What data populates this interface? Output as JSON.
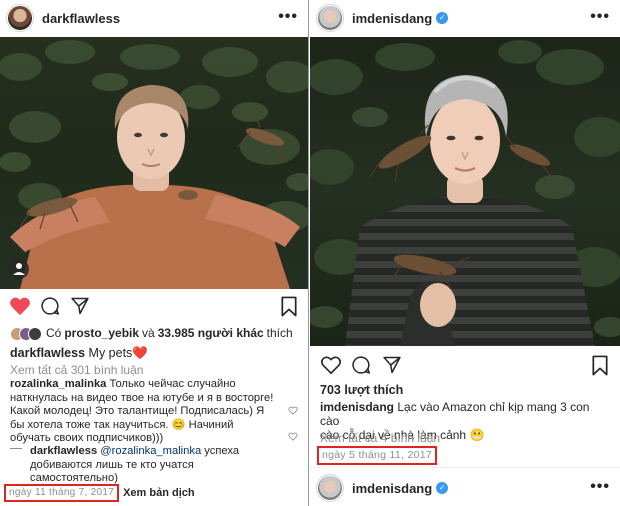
{
  "left_post": {
    "username": "darkflawless",
    "liked_by_prefix": "Có",
    "liked_by_user": "prosto_yebik",
    "liked_by_suffix_and": "và",
    "liked_by_others": "33.985 người khác",
    "liked_by_action": "thích",
    "caption_user": "darkflawless",
    "caption_text": "My pets",
    "caption_emoji": "❤️",
    "view_comments": "Xem tất cả 301 bình luận",
    "comments": [
      {
        "user": "rozalinka_malinka",
        "line1": "Только чейчас случайно",
        "line2": "наткнулась на видео твое на ютубе и я в восторге!",
        "line3": "Какой молодец! Это талантище! Подписалась) Я",
        "line4": "бы хотела тоже так научиться. 😊 Начиний",
        "line5": "обучать своих подписчиков)))"
      },
      {
        "user": "darkflawless",
        "mention": "@rozalinka_malinka",
        "line1": "успеха",
        "line2": "добиваются лишь те кто учатся",
        "line3": "самостоятельно)"
      }
    ],
    "date": "ngày 11 tháng 7, 2017",
    "translate": "Xem bản dịch"
  },
  "right_post": {
    "username": "imdenisdang",
    "likes": "703 lượt thích",
    "caption_user": "imdenisdang",
    "caption_line1": "Lạc vào Amazon chỉ kịp mang 3 con cào",
    "caption_line2": "cào cỗ dại về nhà làm cảnh",
    "caption_emoji": "😬",
    "view_comments": "Xem tất cả 4 bình luận",
    "date": "ngày 5 tháng 11, 2017",
    "next_username": "imdenisdang"
  },
  "colors": {
    "like_red": "#ed4956",
    "highlight_red": "#e0241f",
    "muted": "#8e8e8e",
    "verified_blue": "#3897f0",
    "mention_blue": "#003569"
  }
}
